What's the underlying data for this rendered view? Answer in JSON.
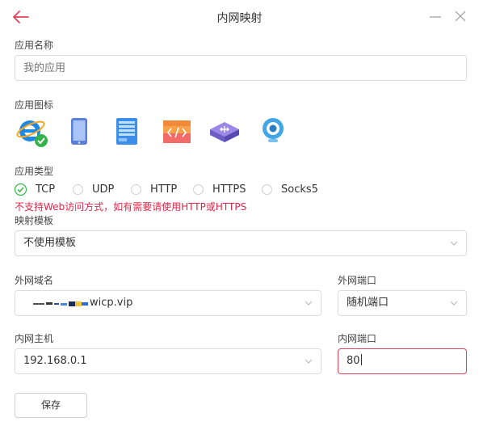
{
  "window": {
    "title": "内网映射",
    "back_icon": "back-arrow-icon",
    "accent": "#e0435a"
  },
  "app_name": {
    "label": "应用名称",
    "placeholder": "我的应用",
    "value": ""
  },
  "app_icon": {
    "label": "应用图标",
    "icons": [
      "ie-browser-icon",
      "tablet-icon",
      "server-icon",
      "code-window-icon",
      "network-switch-icon",
      "webcam-icon"
    ],
    "selected": "ie-browser-icon"
  },
  "app_type": {
    "label": "应用类型",
    "options": [
      "TCP",
      "UDP",
      "HTTP",
      "HTTPS",
      "Socks5"
    ],
    "selected": "TCP",
    "warning": "不支持Web访问方式，如有需要请使用HTTP或HTTPS",
    "warning_color": "#e0264a"
  },
  "template": {
    "label": "映射模板",
    "value": "不使用模板"
  },
  "external_domain": {
    "label": "外网域名",
    "suffix": "wicp.vip"
  },
  "external_port": {
    "label": "外网端口",
    "value": "随机端口"
  },
  "internal_host": {
    "label": "内网主机",
    "value": "192.168.0.1"
  },
  "internal_port": {
    "label": "内网端口",
    "value": "80"
  },
  "save_label": "保存"
}
